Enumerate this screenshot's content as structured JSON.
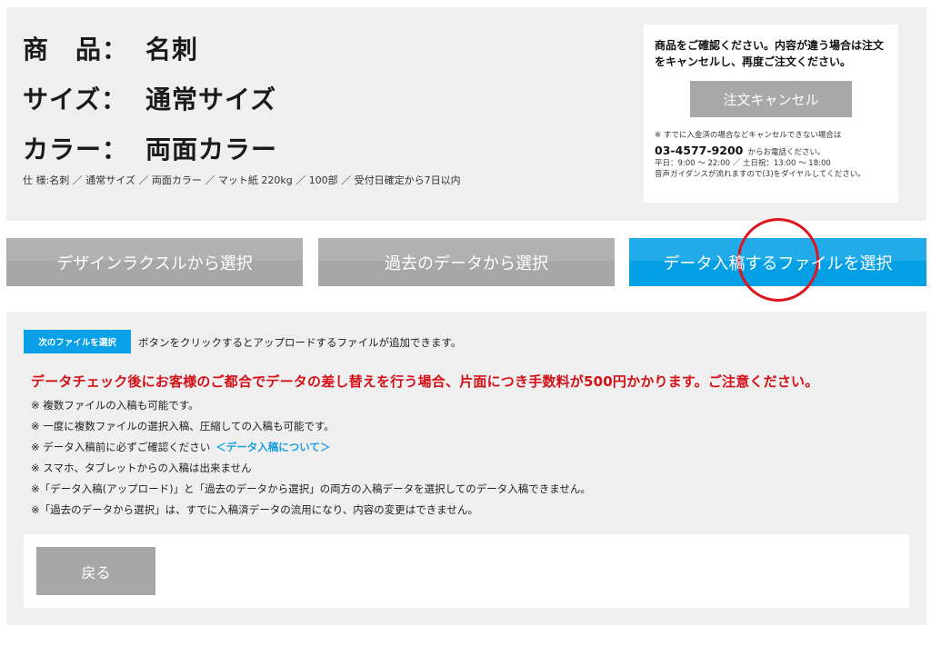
{
  "product": {
    "rows": [
      {
        "label": "商　品：",
        "value": "名刺"
      },
      {
        "label": "サイズ：",
        "value": "通常サイズ"
      },
      {
        "label": "カラー：",
        "value": "両面カラー"
      }
    ],
    "spec_line": "仕 様:名刺 ／ 通常サイズ ／ 両面カラー ／ マット紙 220kg ／ 100部 ／ 受付日確定から7日以内"
  },
  "cancel": {
    "message": "商品をご確認ください。内容が違う場合は注文をキャンセルし、再度ご注文ください。",
    "button_label": "注文キャンセル",
    "note": "※ すでに入金済の場合などキャンセルできない場合は",
    "phone": "03-4577-9200",
    "phone_suffix": "からお電話ください。",
    "hours": "平日：9:00 〜 22:00 ／ 土日祝：13:00 〜 18:00",
    "guidance": "音声ガイダンスが流れますので(3)をダイヤルしてください。"
  },
  "choices": [
    {
      "label": "デザインラクスルから選択"
    },
    {
      "label": "過去のデータから選択"
    },
    {
      "label": "データ入稿するファイルを選択"
    }
  ],
  "colors": {
    "active_button": "#03a0e6",
    "inactive_button": "#a7a7a7",
    "warning_text": "#d50f16",
    "highlight_circle": "#e0141e"
  },
  "upload": {
    "badge_label": "次のファイルを選択",
    "badge_text": "ボタンをクリックするとアップロードするファイルが追加できます。",
    "warning": "データチェック後にお客様のご都合でデータの差し替えを行う場合、片面につき手数料が500円かかります。ご注意ください。",
    "notes": [
      "※ 複数ファイルの入稿も可能です。",
      "※ 一度に複数ファイルの選択入稿、圧縮しての入稿も可能です。",
      "※ データ入稿前に必ずご確認ください",
      "※ スマホ、タブレットからの入稿は出来ません",
      "※「データ入稿(アップロード)」と「過去のデータから選択」の両方の入稿データを選択してのデータ入稿できません。",
      "※「過去のデータから選択」は、すでに入稿済データの流用になり、内容の変更はできません。"
    ],
    "data_link": "＜データ入稿について＞"
  },
  "back_label": "戻る"
}
